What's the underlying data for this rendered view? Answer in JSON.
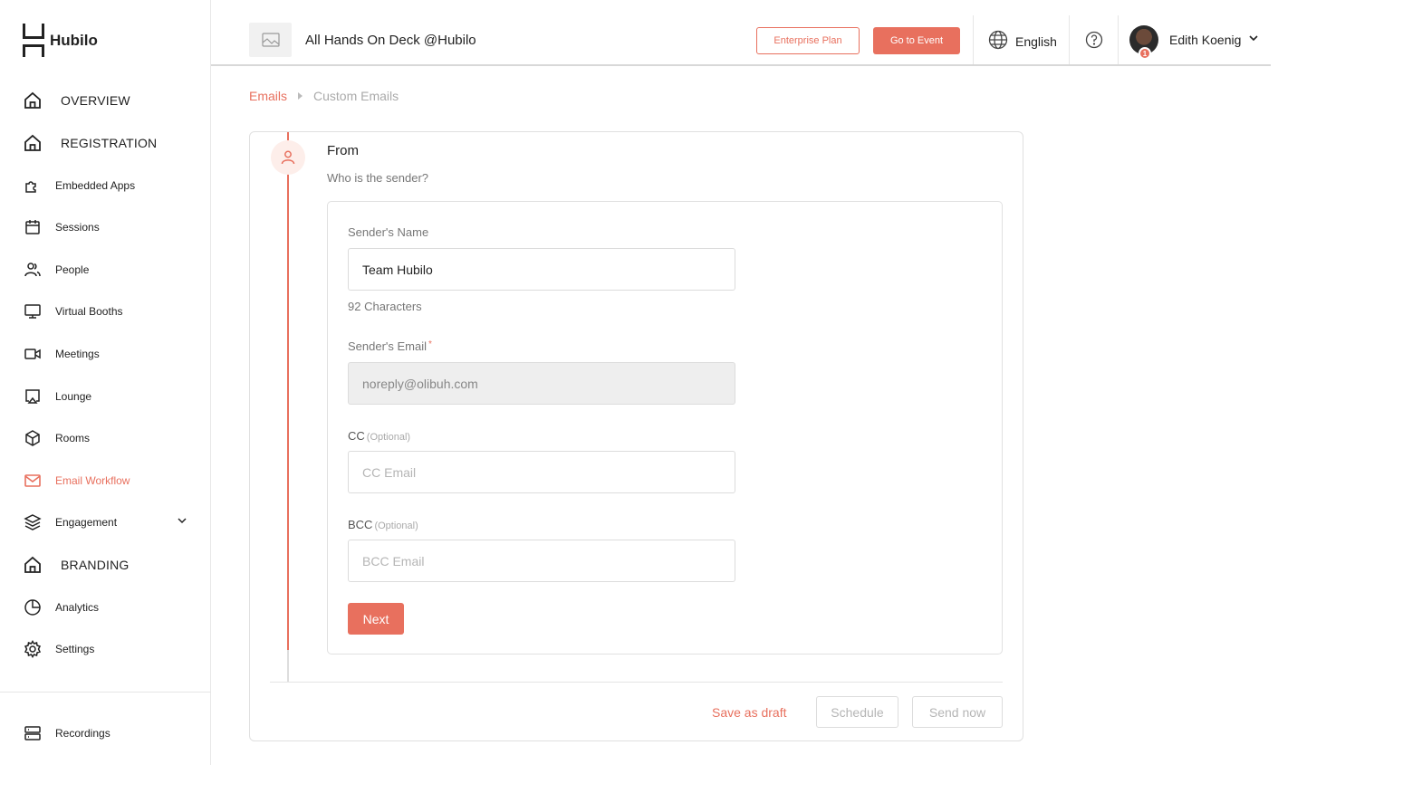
{
  "sidebar": {
    "brand": "Hubilo",
    "items": [
      {
        "label": "OVERVIEW",
        "icon": "home-icon"
      },
      {
        "label": "REGISTRATION",
        "icon": "home-icon"
      },
      {
        "label": "Embedded Apps",
        "icon": "puzzle-icon"
      },
      {
        "label": "Sessions",
        "icon": "calendar-icon"
      },
      {
        "label": "People",
        "icon": "people-icon"
      },
      {
        "label": "Virtual Booths",
        "icon": "monitor-icon"
      },
      {
        "label": "Meetings",
        "icon": "video-icon"
      },
      {
        "label": "Lounge",
        "icon": "cast-icon"
      },
      {
        "label": "Rooms",
        "icon": "cube-icon"
      },
      {
        "label": "Email Workflow",
        "icon": "mail-icon"
      },
      {
        "label": "Engagement",
        "icon": "layers-icon"
      },
      {
        "label": "BRANDING",
        "icon": "home-icon"
      },
      {
        "label": "Analytics",
        "icon": "pie-chart-icon"
      },
      {
        "label": "Settings",
        "icon": "gear-icon"
      },
      {
        "label": "Recordings",
        "icon": "server-icon"
      }
    ],
    "active_color": "#e8705e"
  },
  "header": {
    "event_title": "All Hands On Deck @Hubilo",
    "enterprise_label": "Enterprise Plan",
    "go_to_event_label": "Go to Event",
    "language": "English",
    "user_name": "Edith Koenig",
    "avatar_badge": "1"
  },
  "breadcrumb": {
    "root": "Emails",
    "current": "Custom Emails"
  },
  "step": {
    "title": "From",
    "subtitle": "Who is the sender?"
  },
  "form": {
    "sender_name_label": "Sender's Name",
    "sender_name_value": "Team Hubilo",
    "char_count": "92 Characters",
    "sender_email_label": "Sender's Email",
    "required_mark": "*",
    "sender_email_value": "noreply@olibuh.com",
    "cc_label": "CC",
    "cc_optional": "(Optional)",
    "cc_placeholder": "CC Email",
    "bcc_label": "BCC",
    "bcc_optional": "(Optional)",
    "bcc_placeholder": "BCC Email",
    "next_label": "Next"
  },
  "footer": {
    "draft_label": "Save as draft",
    "schedule_label": "Schedule",
    "send_label": "Send now"
  },
  "colors": {
    "accent": "#e8705e",
    "text": "#222222",
    "muted": "#777777"
  }
}
